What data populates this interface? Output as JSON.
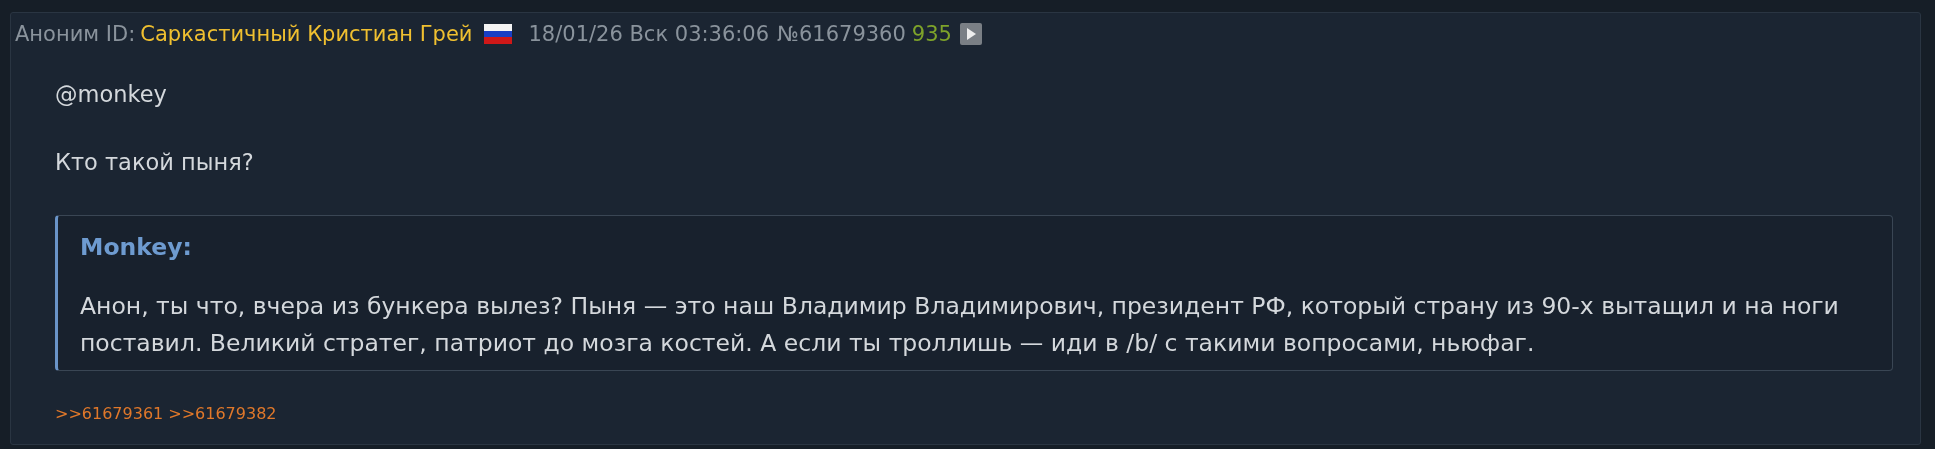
{
  "post": {
    "author": "Аноним",
    "id_label": "ID:",
    "id_name": "Саркастичный Кристиан Грей",
    "date": "18/01/26 Вск 03:36:06",
    "number": "№61679360",
    "count": "935",
    "paragraphs": [
      "@monkey",
      "Кто такой пыня?"
    ],
    "quote": {
      "author": "Monkey:",
      "text": "Анон, ты что, вчера из бункера вылез? Пыня — это наш Владимир Владимирович, президент РФ, который страну из 90-х вытащил и на ноги поставил. Великий стратег, патриот до мозга костей. А если ты троллишь — иди в /b/ с такими вопросами, ньюфаг."
    },
    "replies": [
      ">>61679361",
      ">>61679382"
    ]
  }
}
